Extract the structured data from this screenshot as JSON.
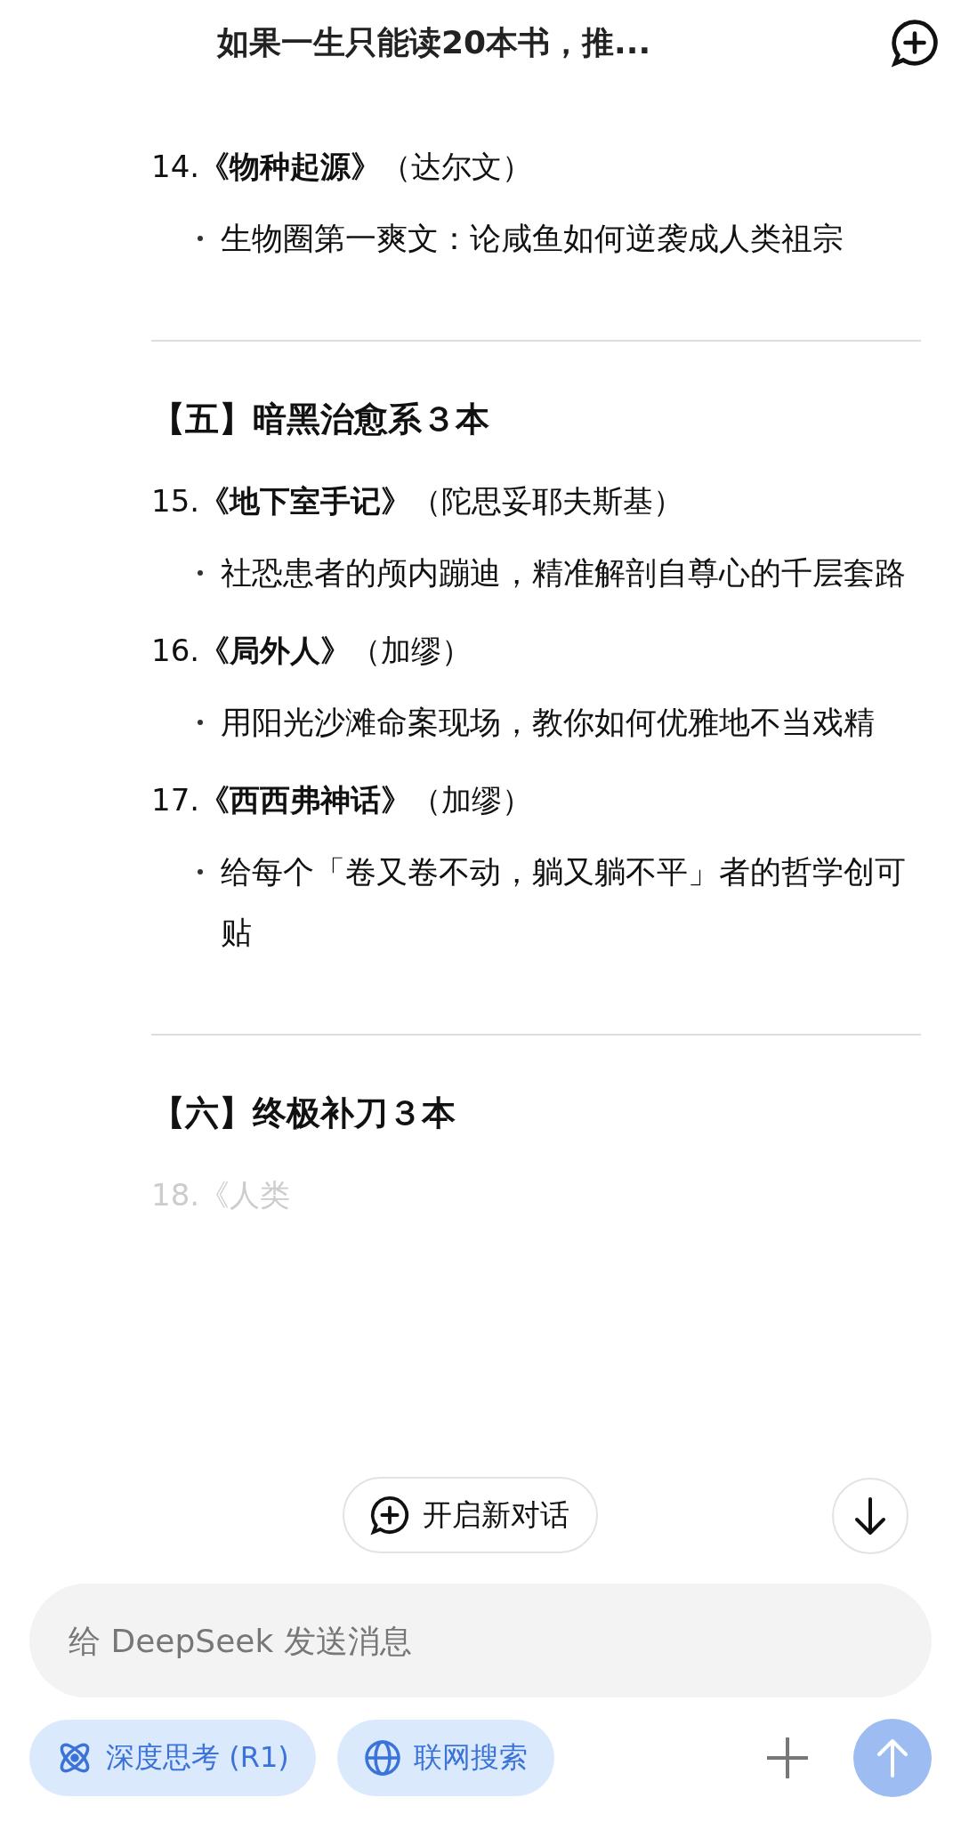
{
  "header": {
    "title": "如果一生只能读20本书，推..."
  },
  "content": [
    {
      "kind": "item",
      "text": "14.**《物种起源》**（达尔文）",
      "bullets": [
        "生物圈第一爽文：论咸鱼如何逆袭成人类祖宗"
      ]
    },
    {
      "kind": "divider"
    },
    {
      "kind": "heading",
      "text": "【五】暗黑治愈系３本"
    },
    {
      "kind": "item",
      "text": "15.**《地下室手记》**（陀思妥耶夫斯基）",
      "bullets": [
        "社恐患者的颅内蹦迪，精准解剖自尊心的千层套路"
      ]
    },
    {
      "kind": "item",
      "text": "16.**《局外人》**（加缪）",
      "bullets": [
        "用阳光沙滩命案现场，教你如何优雅地不当戏精"
      ]
    },
    {
      "kind": "item",
      "text": "17.**《西西弗神话》**（加缪）",
      "bullets": [
        "给每个「卷又卷不动，躺又躺不平」者的哲学创可贴"
      ]
    },
    {
      "kind": "divider"
    },
    {
      "kind": "heading",
      "text": "【六】终极补刀３本"
    },
    {
      "kind": "faded",
      "text": "18.《人类"
    }
  ],
  "new_chat": {
    "label": "开启新对话"
  },
  "composer": {
    "placeholder": "给 DeepSeek 发送消息",
    "toggles": [
      {
        "kind": "atom",
        "label": "深度思考 (R1)",
        "selected": true
      },
      {
        "kind": "globe",
        "label": "联网搜索",
        "selected": true
      }
    ],
    "send_disabled": true
  }
}
